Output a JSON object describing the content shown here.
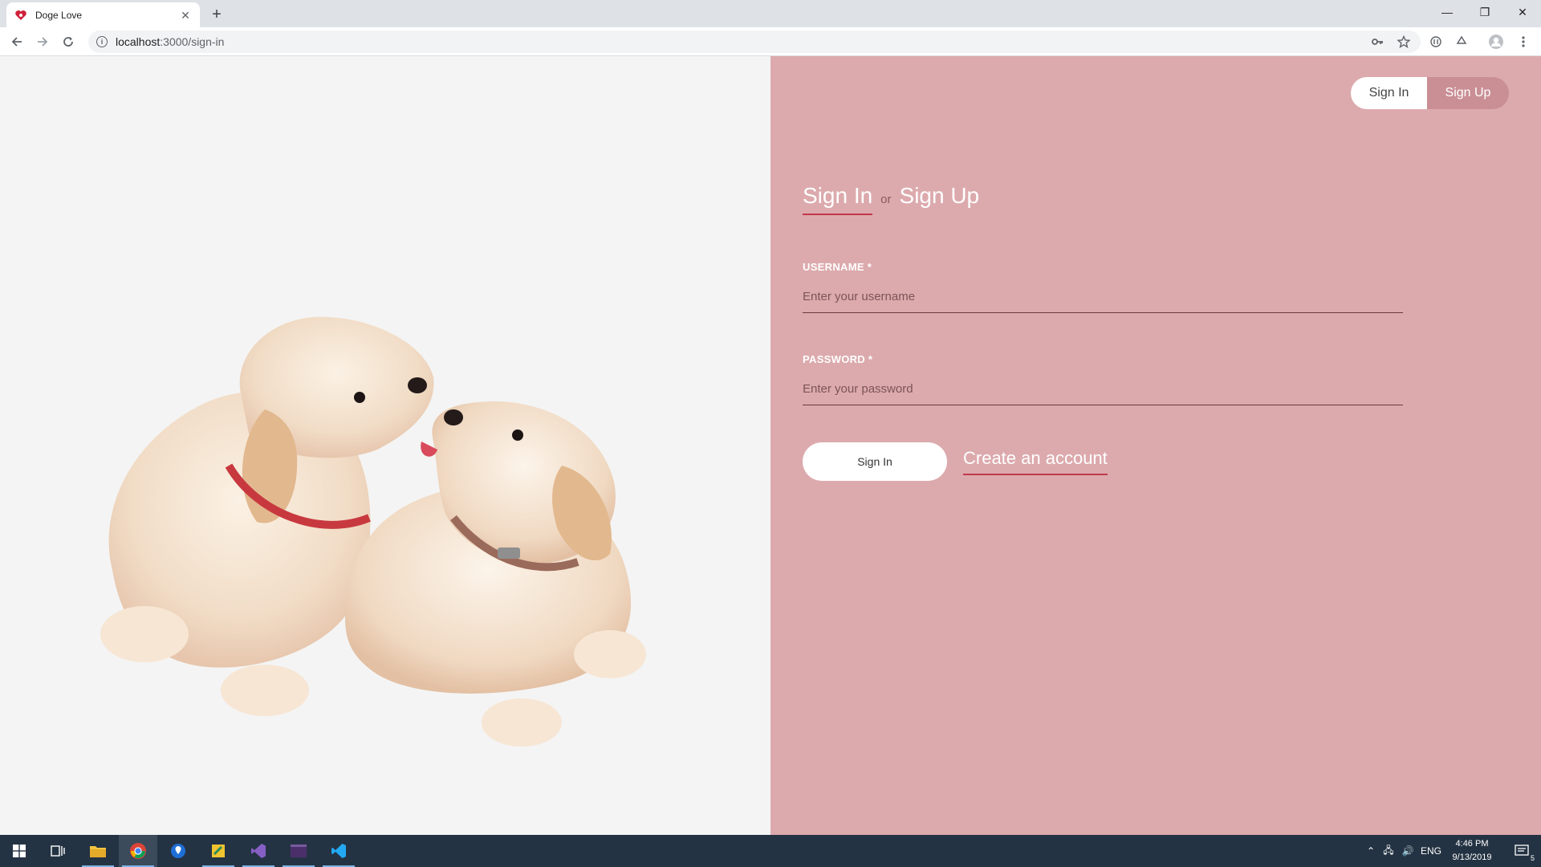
{
  "browser": {
    "tab_title": "Doge Love",
    "tab_close": "✕",
    "new_tab": "+",
    "url_host": "localhost",
    "url_path": ":3000/sign-in",
    "window_controls": {
      "minimize": "—",
      "restore": "❐",
      "close": "✕"
    }
  },
  "header": {
    "signin_label": "Sign In",
    "signup_label": "Sign Up"
  },
  "form": {
    "title_active": "Sign In",
    "title_or": "or",
    "title_other": "Sign Up",
    "username_label": "USERNAME",
    "username_required": "*",
    "username_placeholder": "Enter your username",
    "password_label": "PASSWORD",
    "password_required": "*",
    "password_placeholder": "Enter your password",
    "submit_label": "Sign In",
    "create_account_label": "Create an account"
  },
  "colors": {
    "right_panel": "#dcaaad",
    "accent": "#c0394a",
    "active_pill": "#c98f94"
  },
  "taskbar": {
    "language": "ENG",
    "time": "4:46 PM",
    "date": "9/13/2019",
    "notification_count": "5"
  }
}
